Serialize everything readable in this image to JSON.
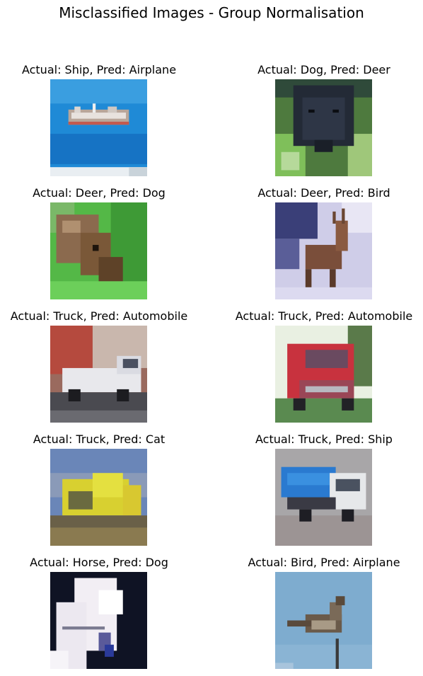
{
  "figure": {
    "title": "Misclassified Images - Group Normalisation"
  },
  "images": [
    {
      "caption": "Actual: Ship, Pred: Airplane",
      "subject": "ship-image"
    },
    {
      "caption": "Actual: Dog, Pred: Deer",
      "subject": "dog-image"
    },
    {
      "caption": "Actual: Deer, Pred: Dog",
      "subject": "deer-image"
    },
    {
      "caption": "Actual: Deer, Pred: Bird",
      "subject": "deer-image"
    },
    {
      "caption": "Actual: Truck, Pred: Automobile",
      "subject": "truck-image"
    },
    {
      "caption": "Actual: Truck, Pred: Automobile",
      "subject": "truck-image"
    },
    {
      "caption": "Actual: Truck, Pred: Cat",
      "subject": "truck-image"
    },
    {
      "caption": "Actual: Truck, Pred: Ship",
      "subject": "truck-image"
    },
    {
      "caption": "Actual: Horse, Pred: Dog",
      "subject": "horse-image"
    },
    {
      "caption": "Actual: Bird, Pred: Airplane",
      "subject": "bird-image"
    }
  ]
}
